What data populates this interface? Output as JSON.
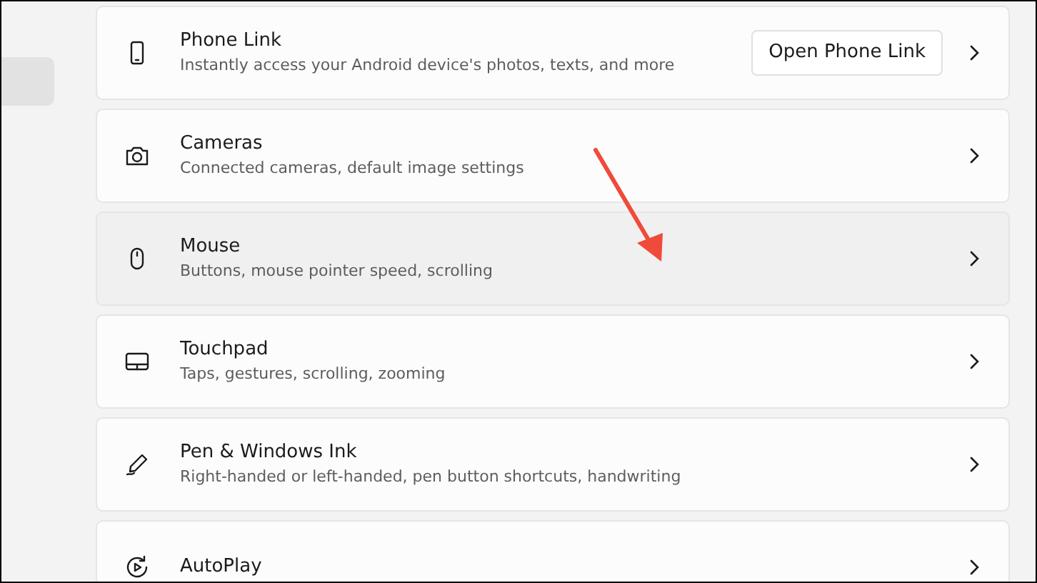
{
  "sidebar": {
    "items": [
      {
        "selected": true
      }
    ]
  },
  "settings": [
    {
      "kind": "button",
      "title": "Phone Link",
      "description": "Instantly access your Android device's photos, texts, and more",
      "button": "Open Phone Link",
      "hovered": false
    },
    {
      "kind": "link",
      "title": "Cameras",
      "description": "Connected cameras, default image settings",
      "hovered": false
    },
    {
      "kind": "link",
      "title": "Mouse",
      "description": "Buttons, mouse pointer speed, scrolling",
      "hovered": true
    },
    {
      "kind": "link",
      "title": "Touchpad",
      "description": "Taps, gestures, scrolling, zooming",
      "hovered": false
    },
    {
      "kind": "link",
      "title": "Pen & Windows Ink",
      "description": "Right-handed or left-handed, pen button shortcuts, handwriting",
      "hovered": false
    },
    {
      "kind": "link",
      "title": "AutoPlay",
      "hovered": false
    }
  ]
}
